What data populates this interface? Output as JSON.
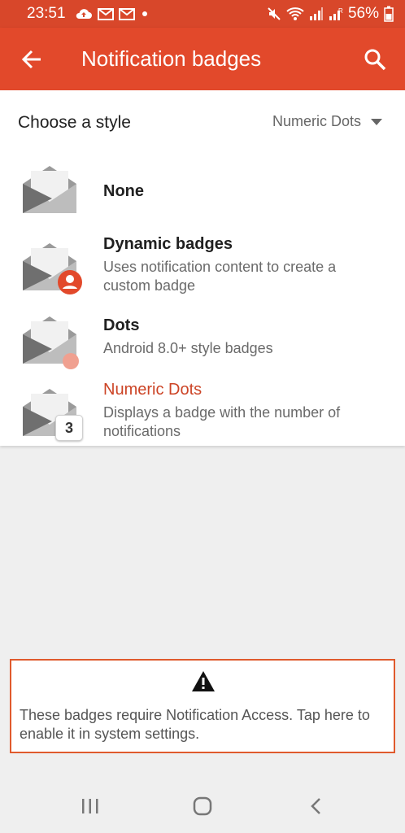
{
  "status_bar": {
    "time": "23:51",
    "battery": "56%",
    "icons": [
      "cloud-upload-icon",
      "mail-icon",
      "mail-icon",
      "dot-icon",
      "mute-icon",
      "wifi-icon",
      "signal-icon",
      "signal-r-icon",
      "battery-icon"
    ]
  },
  "app_bar": {
    "title": "Notification badges",
    "back_icon": "arrow-back-icon",
    "search_icon": "search-icon"
  },
  "style_picker": {
    "label": "Choose a style",
    "selected": "Numeric Dots"
  },
  "options": [
    {
      "title": "None",
      "description": "",
      "badge": ""
    },
    {
      "title": "Dynamic badges",
      "description": "Uses notification content to create a custom badge",
      "badge": "person-icon"
    },
    {
      "title": "Dots",
      "description": "Android 8.0+ style badges",
      "badge": "dot"
    },
    {
      "title": "Numeric Dots",
      "description": "Displays a badge with the number of notifications",
      "badge": "3",
      "selected": true
    }
  ],
  "banner": {
    "icon": "warning-icon",
    "text": "These badges require Notification Access. Tap here to enable it in system settings."
  },
  "nav": {
    "recents": "recents-icon",
    "home": "home-icon",
    "back": "back-icon"
  },
  "colors": {
    "accent": "#e2492b",
    "highlight_border": "#e05a2d",
    "dot_badge": "#f0a090",
    "selected_text": "#cc4426"
  }
}
